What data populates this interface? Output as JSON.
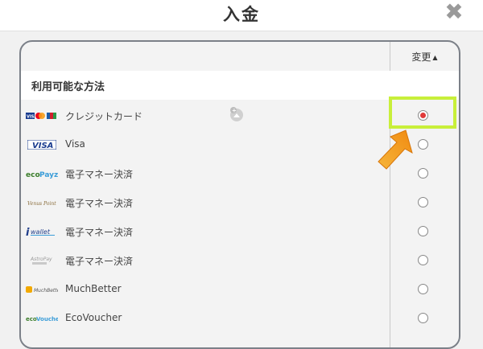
{
  "modal": {
    "title": "入金",
    "close_icon": "close-icon"
  },
  "panel": {
    "change_label": "変更",
    "section_title": "利用可能な方法"
  },
  "methods": [
    {
      "label": "クレジットカード",
      "logo": "visa-mastercard-jcb-logo",
      "selected": true,
      "bonus_icon": true
    },
    {
      "label": "Visa",
      "logo": "visa-logo",
      "selected": false
    },
    {
      "label": "電子マネー決済",
      "logo": "ecopayz-logo",
      "selected": false
    },
    {
      "label": "電子マネー決済",
      "logo": "venus-point-logo",
      "selected": false
    },
    {
      "label": "電子マネー決済",
      "logo": "iwallet-logo",
      "selected": false
    },
    {
      "label": "電子マネー決済",
      "logo": "astropay-logo",
      "selected": false
    },
    {
      "label": "MuchBetter",
      "logo": "muchbetter-logo",
      "selected": false
    },
    {
      "label": "EcoVoucher",
      "logo": "ecovoucher-logo",
      "selected": false
    }
  ],
  "colors": {
    "highlight": "#c8ef3a",
    "radio_selected": "#e03a3a",
    "arrow": "#f39a1e"
  }
}
